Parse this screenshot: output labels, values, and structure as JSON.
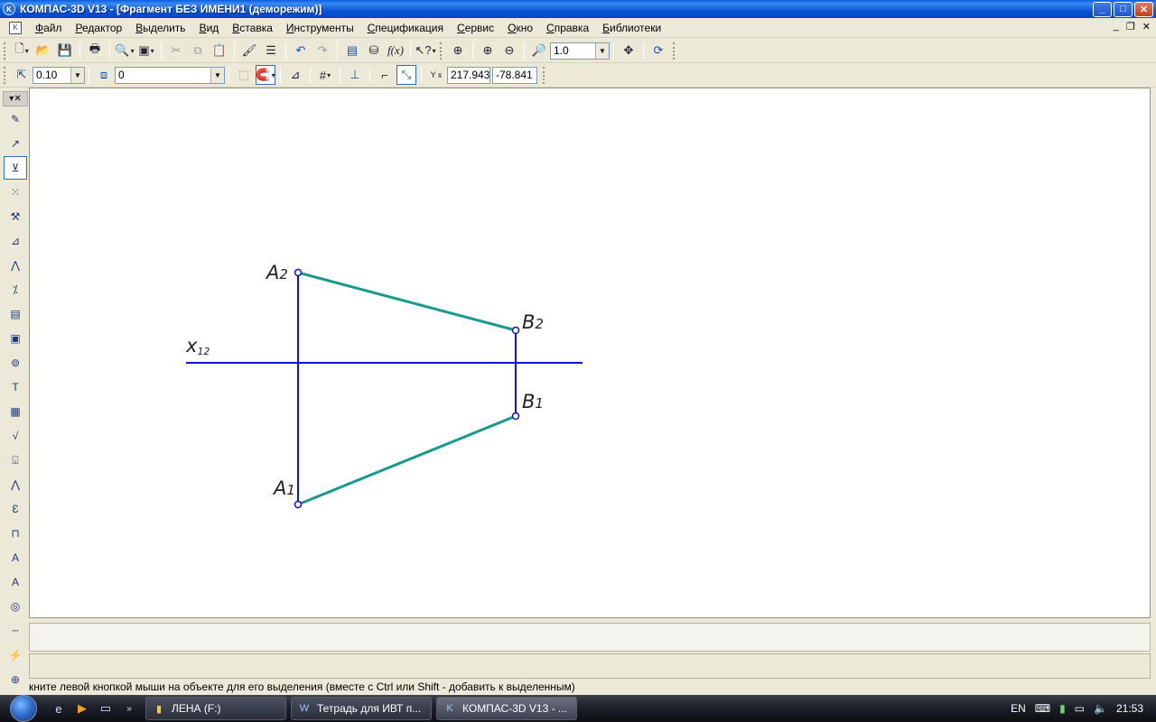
{
  "window": {
    "title": "КОМПАС-3D V13 - [Фрагмент БЕЗ ИМЕНИ1 (деморежим)]",
    "icon": "kompas-logo-icon",
    "minimize": "_",
    "maximize": "□",
    "close": "✕"
  },
  "menu": {
    "items": [
      "Файл",
      "Редактор",
      "Выделить",
      "Вид",
      "Вставка",
      "Инструменты",
      "Спецификация",
      "Сервис",
      "Окно",
      "Справка",
      "Библиотеки"
    ],
    "mdi_minimize": "_",
    "mdi_restore": "❐",
    "mdi_close": "✕"
  },
  "toolbar1": {
    "zoom_value": "1.0"
  },
  "toolbar2": {
    "step_value": "0.10",
    "layer_value": "0",
    "coord_x": "217.943",
    "coord_y": "-78.841",
    "coord_axis_label": "Y x"
  },
  "drawing": {
    "axis_label": "x",
    "axis_sub": "12",
    "points": [
      {
        "name": "A",
        "sub": "2"
      },
      {
        "name": "B",
        "sub": "2"
      },
      {
        "name": "B",
        "sub": "1"
      },
      {
        "name": "A",
        "sub": "1"
      }
    ],
    "colors": {
      "axis_line": "#1010d0",
      "projection_line": "#1a9a8e",
      "point": "#1010d0"
    }
  },
  "status": {
    "hint": "кните левой кнопкой мыши на объекте для его выделения (вместе с Ctrl или Shift - добавить к выделенным)"
  },
  "taskbar": {
    "tasks": [
      {
        "label": "ЛЕНА (F:)",
        "icon": "folder-icon"
      },
      {
        "label": "Тетрадь для ИВТ п...",
        "icon": "word-document-icon"
      },
      {
        "label": "КОМПАС-3D V13 - ...",
        "icon": "kompas-logo-icon"
      }
    ],
    "language": "EN",
    "clock": "21:53"
  }
}
